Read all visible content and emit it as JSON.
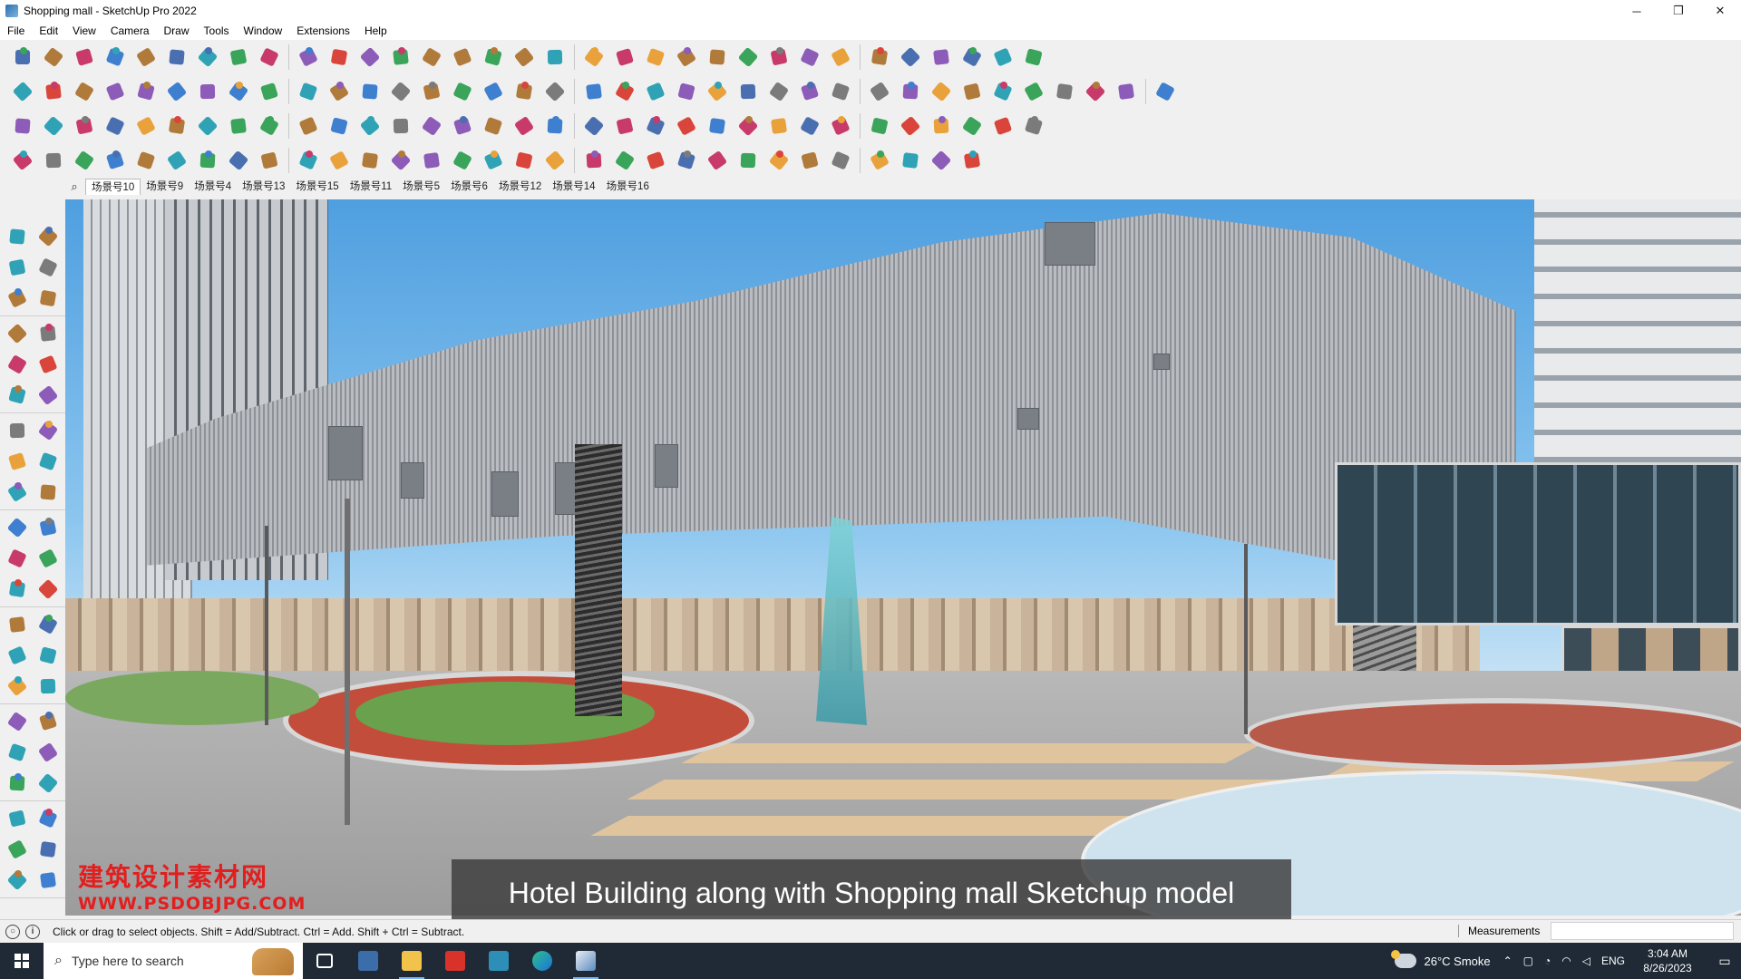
{
  "window": {
    "title": "Shopping mall - SketchUp Pro 2022",
    "controls": [
      "─",
      "❐",
      "✕"
    ]
  },
  "menu": [
    "File",
    "Edit",
    "View",
    "Camera",
    "Draw",
    "Tools",
    "Window",
    "Extensions",
    "Help"
  ],
  "scenes": {
    "active": "场景号10",
    "tabs": [
      "场景号10",
      "场景号9",
      "场景号4",
      "场景号13",
      "场景号15",
      "场景号11",
      "场景号5",
      "场景号6",
      "场景号12",
      "场景号14",
      "场景号16"
    ]
  },
  "toolbar_icons": {
    "row1": [
      "zoom-icon",
      "select-icon",
      "eraser-icon",
      "pencil-icon",
      "lasso-icon",
      "rectangle-icon",
      "push-pull-icon",
      "follow-me-icon",
      "move-icon",
      "rotate-icon",
      "scale-icon",
      "tape-measure-icon",
      "text-icon",
      "paint-bucket-icon",
      "orbit-icon",
      "pan-icon",
      "zoom-window-icon",
      "zoom-extents-icon",
      "components-icon",
      "sandbox-icon",
      "layers-icon",
      "styles-icon",
      "warehouse-icon",
      "section-icon",
      "section-fill-icon",
      "axis-icon",
      "flip-icon",
      "flip-icon",
      "triangle-icon",
      "mirror-icon",
      "undo-icon",
      "redo-icon",
      "user-icon"
    ],
    "row2": [
      "cube-icon",
      "cube-shaded-icon",
      "cube-texture-icon",
      "solid-union-icon",
      "solid-subtract-icon",
      "solid-intersect-icon",
      "solid-trim-icon",
      "solid-split-icon",
      "shell-icon",
      "outer-shell-icon",
      "sketch-icon",
      "section-plane-icon",
      "section-cut-icon",
      "section-display-icon",
      "box-icon",
      "house-icon",
      "roof-icon",
      "window-icon",
      "door-icon",
      "stair-icon",
      "font-icon",
      "curve-icon",
      "knife-icon",
      "circle-icon",
      "polygon-icon",
      "ellipse-icon",
      "arc-icon",
      "spiral-icon",
      "bezier-icon",
      "offset-icon",
      "fillet-icon",
      "chamfer-icon",
      "extrude-icon",
      "loft-icon",
      "sweep-icon",
      "texture-icon",
      "material-icon"
    ],
    "row3": [
      "plane-icon",
      "plane-blue-icon",
      "plane-yellow-icon",
      "auto-text-icon",
      "face-icon",
      "wall-icon",
      "frame-icon",
      "block-icon",
      "arc-tool-icon",
      "spline-icon",
      "add-icon",
      "plus-cross-icon",
      "grid-icon",
      "cone-icon",
      "warning-icon",
      "loop-icon",
      "hook-icon",
      "curl-icon",
      "star-icon",
      "cut-icon",
      "undo-curve-icon",
      "tree-icon",
      "component-icon",
      "array-icon",
      "copy-icon",
      "paint-icon",
      "mesh-icon",
      "ruler-icon",
      "hatch-icon",
      "hatch-box-icon",
      "dots-icon",
      "node-icon",
      "flow-icon"
    ],
    "row4": [
      "draw-line-icon",
      "poly-icon",
      "car-icon",
      "brush-icon",
      "bend-icon",
      "shape-icon",
      "twist-icon",
      "path-icon",
      "corner-icon",
      "corner2-icon",
      "slope-icon",
      "hook2-icon",
      "grip-icon",
      "railing-icon",
      "balusters-icon",
      "glass-icon",
      "arrow-spread-icon",
      "branch-icon",
      "fan-icon",
      "fork-icon",
      "vent-icon",
      "stairs-icon",
      "panel-icon",
      "facade-icon",
      "pattern-icon",
      "columns-icon",
      "mesh-ball-icon",
      "sphere-icon",
      "fins-icon",
      "truss-icon",
      "leaf-icon"
    ]
  },
  "left_tools": [
    "select-icon",
    "orbit-small-icon",
    "paint-bucket-icon",
    "eraser-icon",
    "components-icon",
    "tag-icon",
    "pencil-icon",
    "freehand-icon",
    "rectangle-icon",
    "rotated-rectangle-icon",
    "circle-icon",
    "polygon-icon",
    "arc-icon",
    "pie-icon",
    "two-point-arc-icon",
    "3-point-arc-icon",
    "move-icon",
    "push-pull-icon",
    "rotate-icon",
    "follow-me-icon",
    "scale-icon",
    "offset-icon",
    "tape-measure-icon",
    "dimension-icon",
    "protractor-icon",
    "text-icon",
    "axes-icon",
    "3d-text-icon",
    "orbit-icon",
    "pan-icon",
    "zoom-icon",
    "zoom-window-icon",
    "zoom-extents-icon",
    "previous-view-icon",
    "position-camera-icon",
    "look-around-icon",
    "walk-icon",
    "section-plane-icon",
    "sandbox-icon",
    "layers-icon",
    "smoove-icon",
    "stamp-icon"
  ],
  "watermark": {
    "line1": "建筑设计素材网",
    "line2": "WWW.PSDOBJPG.COM"
  },
  "caption": "Hotel Building along with Shopping mall Sketchup model",
  "status": {
    "message": "Click or drag to select objects. Shift = Add/Subtract. Ctrl = Add. Shift + Ctrl = Subtract.",
    "measurements_label": "Measurements",
    "measurements_value": ""
  },
  "taskbar": {
    "search_placeholder": "Type here to search",
    "apps": [
      "task-view-icon",
      "calculator-icon",
      "file-explorer-icon",
      "acrobat-icon",
      "media-icon",
      "edge-icon",
      "sketchup-icon"
    ],
    "weather": "26°C  Smoke",
    "language": "ENG",
    "time": "3:04 AM",
    "date": "8/26/2023"
  },
  "colors": {
    "sky": "#5aa6e4",
    "caption_bg": "#3c3c3c",
    "watermark": "#e21e1e",
    "taskbar": "#1f2a36"
  }
}
